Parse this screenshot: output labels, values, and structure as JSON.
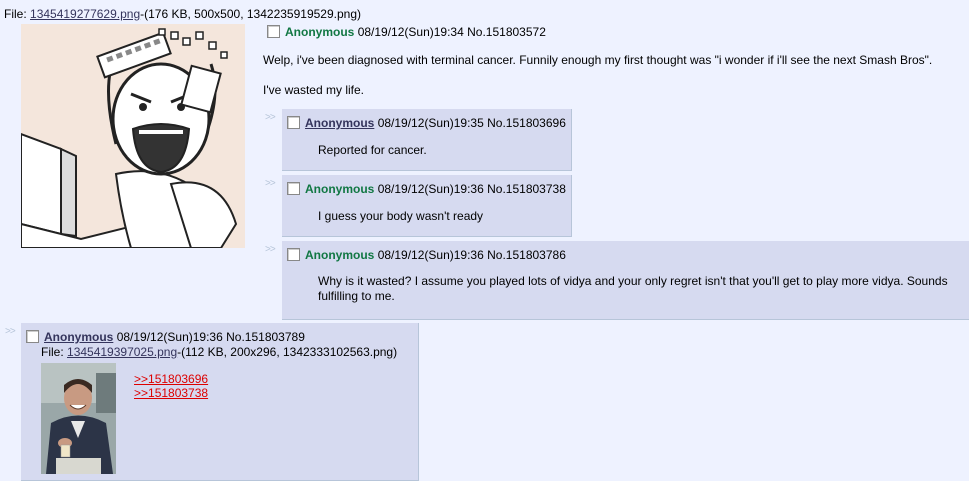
{
  "op": {
    "file_prefix": "File: ",
    "file_name": "1345419277629.png",
    "file_info": "-(176 KB, 500x500, 1342235919529.png)",
    "image_icon": "rage-face-smashing-keyboard-image",
    "name": "Anonymous",
    "datetime": "08/19/12(Sun)19:34",
    "post_no": "No.151803572",
    "message_line1": "Welp, i've been diagnosed with terminal cancer. Funnily enough my first thought was \"i wonder if i'll see the next Smash Bros\".",
    "message_line2": "I've wasted my life."
  },
  "replies": [
    {
      "arrows": ">>",
      "name": "Anonymous",
      "datetime": "08/19/12(Sun)19:35",
      "post_no": "No.151803696",
      "message": "Reported for cancer."
    },
    {
      "arrows": ">>",
      "name": "Anonymous",
      "datetime": "08/19/12(Sun)19:36",
      "post_no": "No.151803738",
      "message": "I guess your body wasn't ready"
    },
    {
      "arrows": ">>",
      "name": "Anonymous",
      "datetime": "08/19/12(Sun)19:36",
      "post_no": "No.151803786",
      "message": "Why is it wasted? I assume you played lots of vidya and your only regret isn't that you'll get to play more vidya. Sounds fulfilling to me."
    },
    {
      "arrows": ">>",
      "name": "Anonymous",
      "datetime": "08/19/12(Sun)19:36",
      "post_no": "No.151803789",
      "file_prefix": "File: ",
      "file_name": "1345419397025.png",
      "file_info": "-(112 KB, 200x296, 1342333102563.png)",
      "image_icon": "laughing-man-photo-image",
      "quote1": ">>151803696",
      "quote2": ">>151803738"
    }
  ],
  "colors": {
    "page_bg": "#EEF2FF",
    "reply_bg": "#D6DAF0",
    "name": "#117743",
    "link": "#34345C",
    "quote": "#DD0000"
  }
}
